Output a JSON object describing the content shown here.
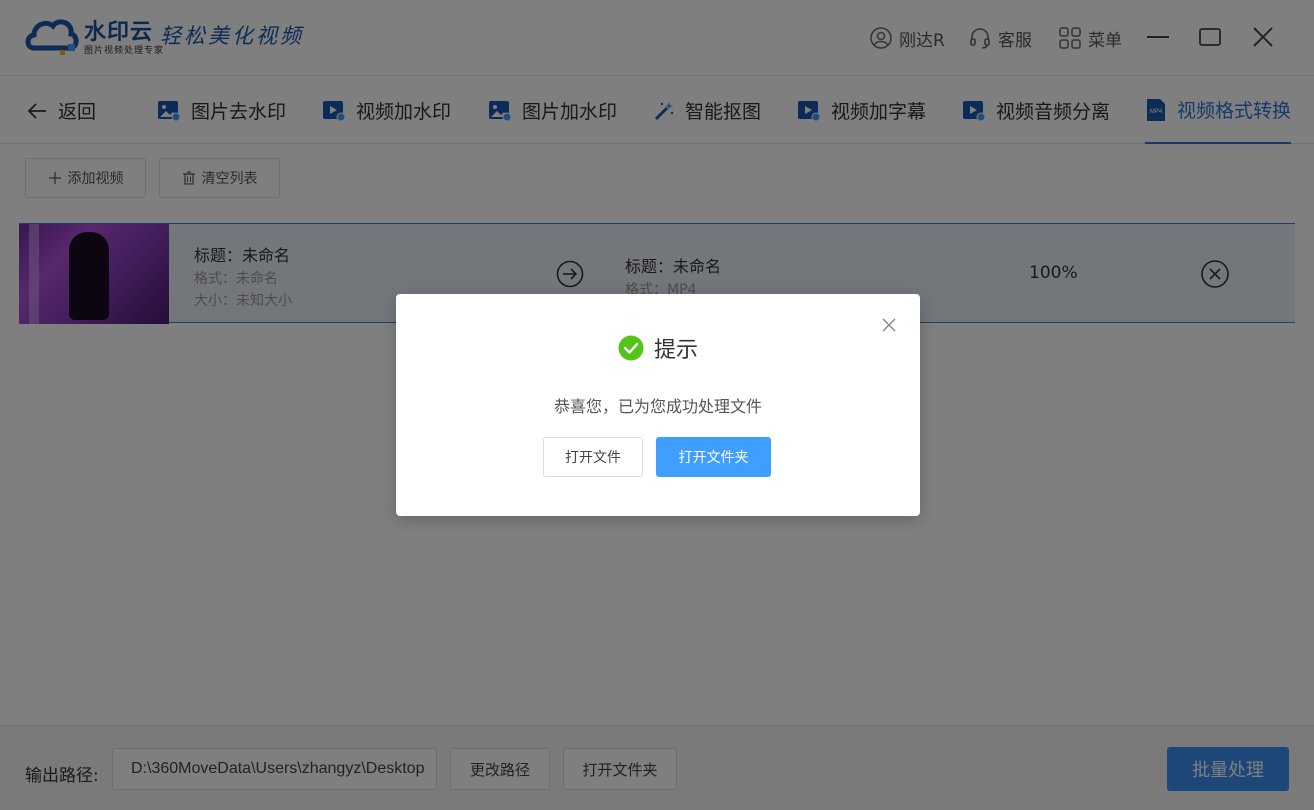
{
  "titlebar": {
    "brand": "水印云",
    "brand_sub": "图片视频处理专家",
    "slogan": "轻松美化视频",
    "user": "刚达R",
    "service": "客服",
    "menu": "菜单"
  },
  "nav": {
    "back": "返回",
    "items": [
      {
        "label": "图片去水印"
      },
      {
        "label": "视频加水印"
      },
      {
        "label": "图片加水印"
      },
      {
        "label": "智能抠图"
      },
      {
        "label": "视频加字幕"
      },
      {
        "label": "视频音频分离"
      },
      {
        "label": "视频格式转换"
      }
    ],
    "mp4_badge": "MP4"
  },
  "toolbar": {
    "add_video": "添加视频",
    "clear_list": "清空列表"
  },
  "file": {
    "src_title": "标题：未命名",
    "src_format": "格式：未命名",
    "src_size": "大小：未知大小",
    "dst_title": "标题：未命名",
    "dst_format": "格式：MP4",
    "progress": "100%"
  },
  "footer": {
    "output_label": "输出路径:",
    "output_path": "D:\\360MoveData\\Users\\zhangyz\\Desktop",
    "change_path": "更改路径",
    "open_folder": "打开文件夹",
    "batch": "批量处理"
  },
  "dialog": {
    "title": "提示",
    "message": "恭喜您，已为您成功处理文件",
    "open_file": "打开文件",
    "open_folder": "打开文件夹"
  },
  "colors": {
    "accent": "#2b74d8",
    "primary_button": "#409eff",
    "success": "#52c41a"
  }
}
